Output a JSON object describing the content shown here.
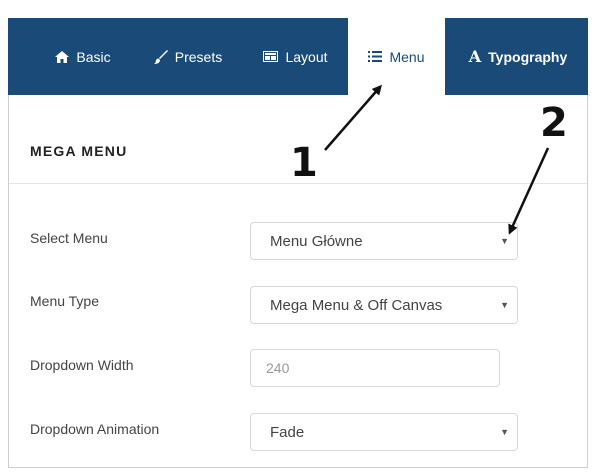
{
  "tabs": [
    {
      "label": "Basic",
      "icon": "home-icon",
      "active": false
    },
    {
      "label": "Presets",
      "icon": "brush-icon",
      "active": false
    },
    {
      "label": "Layout",
      "icon": "layout-icon",
      "active": false
    },
    {
      "label": "Menu",
      "icon": "list-icon",
      "active": true
    },
    {
      "label": "Typography",
      "icon": "font-icon",
      "active": false
    }
  ],
  "typography_icon_glyph": "A",
  "section": {
    "title": "MEGA MENU"
  },
  "fields": [
    {
      "label": "Select Menu",
      "type": "select",
      "value": "Menu Główne"
    },
    {
      "label": "Menu Type",
      "type": "select",
      "value": "Mega Menu & Off Canvas"
    },
    {
      "label": "Dropdown Width",
      "type": "input",
      "value": "",
      "placeholder": "240"
    },
    {
      "label": "Dropdown Animation",
      "type": "select",
      "value": "Fade"
    }
  ],
  "annotations": [
    {
      "number": "1"
    },
    {
      "number": "2"
    }
  ],
  "colors": {
    "tab_bar": "#1a4b78",
    "tab_text": "#ffffff",
    "active_tab_bg": "#ffffff"
  }
}
